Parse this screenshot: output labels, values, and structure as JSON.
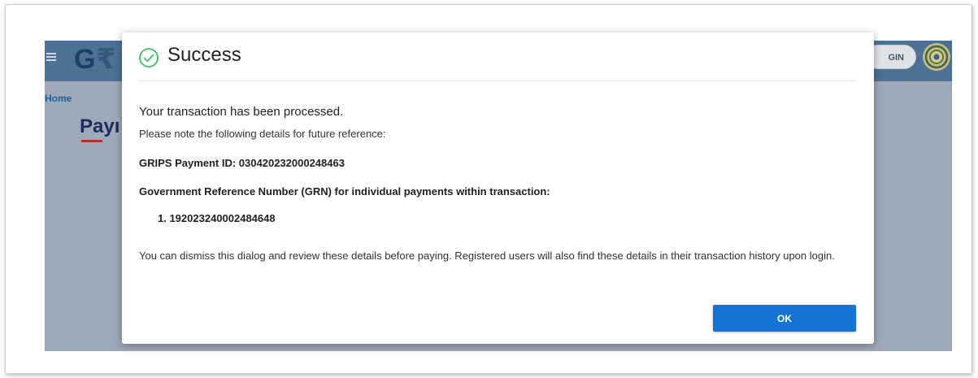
{
  "app": {
    "logo_letter": "G",
    "logo_rupee": "₹",
    "login_label": "GIN",
    "breadcrumb": "Home",
    "page_title_fragment": "Payı"
  },
  "dialog": {
    "title": "Success",
    "message": "Your transaction has been processed.",
    "note": "Please note the following details for future reference:",
    "payment_id_line": "GRIPS Payment ID: 030420232000248463",
    "grn_heading": "Government Reference Number (GRN) for individual payments within transaction:",
    "grn_items": [
      "1. 192023240002484648"
    ],
    "dismiss_text": "You can dismiss this dialog and review these details before paying. Registered users will also find these details in their transaction history upon login.",
    "ok_label": "OK"
  },
  "colors": {
    "success_green": "#3cbf5e",
    "primary_button": "#1474d4",
    "header_bg": "#4d7194"
  },
  "icons": {
    "success": "check-circle-icon",
    "menu": "hamburger-menu-icon",
    "emblem": "state-emblem-icon"
  }
}
